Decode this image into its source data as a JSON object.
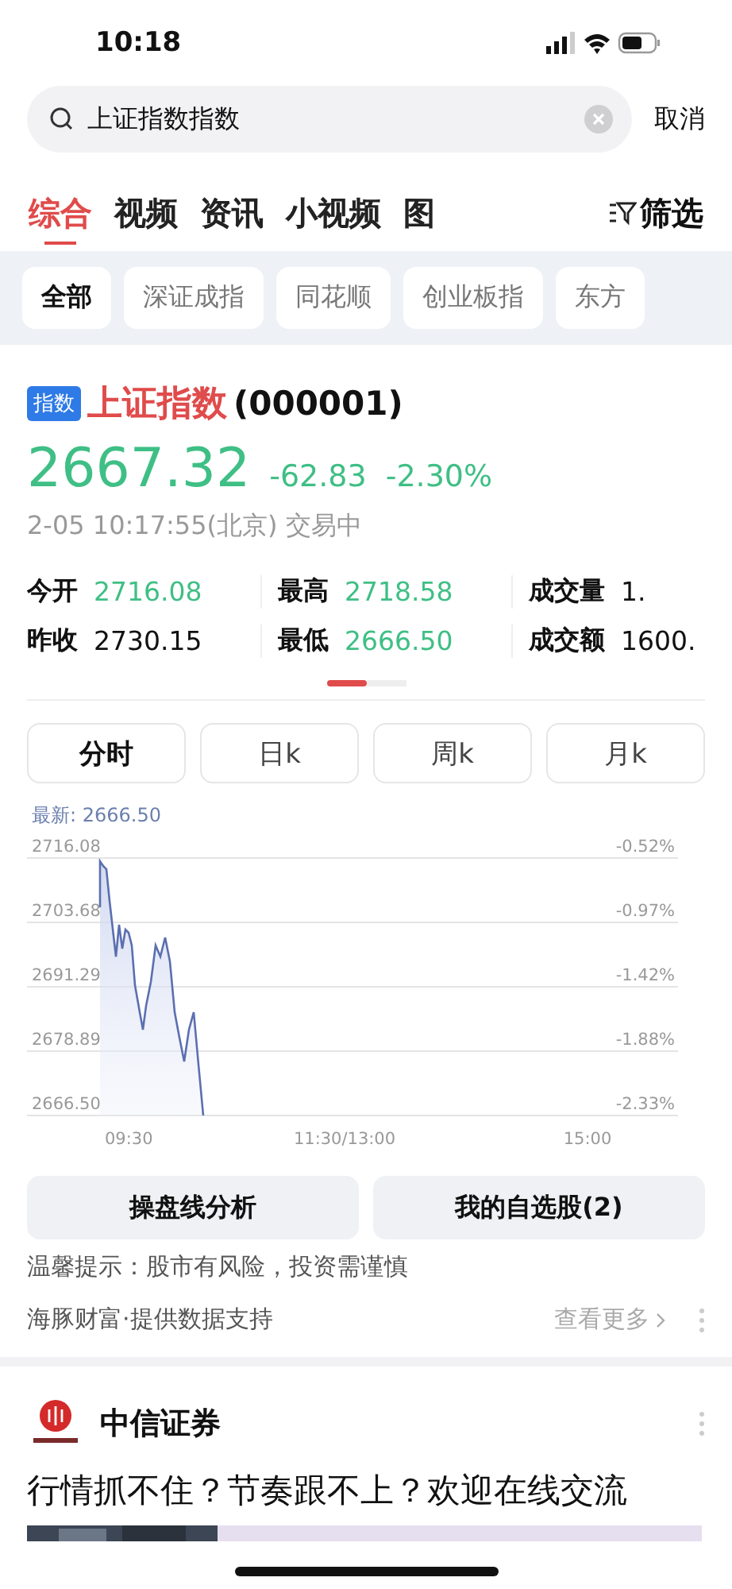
{
  "status_bar": {
    "time": "10:18"
  },
  "search": {
    "value": "上证指数指数",
    "cancel": "取消"
  },
  "tabs": [
    {
      "label": "综合",
      "selected": true
    },
    {
      "label": "视频",
      "selected": false
    },
    {
      "label": "资讯",
      "selected": false
    },
    {
      "label": "小视频",
      "selected": false
    },
    {
      "label": "图",
      "selected": false
    }
  ],
  "filter": "筛选",
  "chips": [
    {
      "label": "全部",
      "selected": true
    },
    {
      "label": "深证成指",
      "selected": false
    },
    {
      "label": "同花顺",
      "selected": false
    },
    {
      "label": "创业板指",
      "selected": false
    },
    {
      "label": "东方",
      "selected": false
    }
  ],
  "quote": {
    "badge": "指数",
    "name": "上证指数",
    "code": "(000001)",
    "price": "2667.32",
    "change": "-62.83",
    "change_pct": "-2.30%",
    "time": "2-05 10:17:55(北京) 交易中"
  },
  "stats": [
    {
      "label": "今开",
      "value": "2716.08",
      "color": "#3fbf85"
    },
    {
      "label": "最高",
      "value": "2718.58",
      "color": "#3fbf85"
    },
    {
      "label": "成交量",
      "value": "1.",
      "color": "#111111"
    },
    {
      "label": "昨收",
      "value": "2730.15",
      "color": "#111111"
    },
    {
      "label": "最低",
      "value": "2666.50",
      "color": "#3fbf85"
    },
    {
      "label": "成交额",
      "value": "1600.",
      "color": "#111111"
    }
  ],
  "pages": [
    {
      "selected": true
    },
    {
      "selected": false
    }
  ],
  "timeframes": [
    {
      "label": "分时",
      "selected": true
    },
    {
      "label": "日k",
      "selected": false
    },
    {
      "label": "周k",
      "selected": false
    },
    {
      "label": "月k",
      "selected": false
    }
  ],
  "latest": "最新: 2666.50",
  "chart": {
    "price_labels": [
      "2716.08",
      "2703.68",
      "2691.29",
      "2678.89",
      "2666.50"
    ],
    "percent_labels": [
      "-0.52%",
      "-0.97%",
      "-1.42%",
      "-1.88%",
      "-2.33%"
    ],
    "time_labels": [
      "09:30",
      "11:30/13:00",
      "15:00"
    ]
  },
  "actions": [
    "操盘线分析",
    "我的自选股(2)"
  ],
  "notice": "温馨提示：股市有风险，投资需谨慎",
  "source": "海豚财富·提供数据支持",
  "more": "查看更多",
  "news": {
    "publisher": "中信证券",
    "headline": "行情抓不住？节奏跟不上？欢迎在线交流"
  }
}
